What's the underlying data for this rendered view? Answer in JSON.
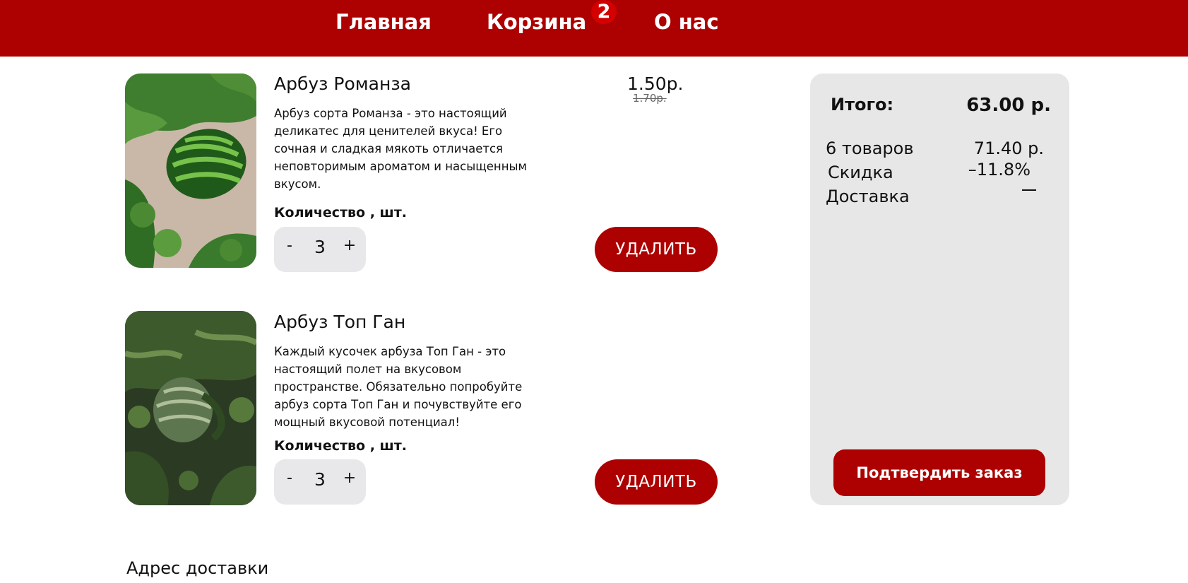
{
  "nav": {
    "home_label": "Главная",
    "cart_label": "Корзина",
    "cart_count": "2",
    "about_label": "О нас"
  },
  "items": [
    {
      "title": "Арбуз Романза",
      "description": "Арбуз сорта Романза - это настоящий деликатес для ценителей вкуса! Его сочная и сладкая мякоть отличается неповторимым ароматом и насыщенным вкусом.",
      "quantity_label": "Количество , шт.",
      "quantity": "3",
      "minus_label": "-",
      "plus_label": "+",
      "price": "1.50р.",
      "old_price": "1.70р.",
      "delete_label": "УДАЛИТЬ"
    },
    {
      "title": "Арбуз Топ Ган",
      "description": "Каждый кусочек арбуза Топ Ган - это настоящий полет на вкусовом пространстве. Обязательно попробуйте арбуз сорта Топ Ган и почувствуйте его мощный вкусовой потенциал!",
      "quantity_label": "Количество , шт.",
      "quantity": "3",
      "minus_label": "-",
      "plus_label": "+",
      "delete_label": "УДАЛИТЬ"
    }
  ],
  "summary": {
    "total_label": "Итого:",
    "total_value": "63.00 р.",
    "items_label": "6 товаров",
    "items_value": "71.40 р.",
    "discount_label": "Скидка",
    "discount_value": "–11.8%",
    "delivery_label": "Доставка",
    "confirm_label": "Подтвердить заказ"
  },
  "address": {
    "title": "Адрес доставки"
  },
  "colors": {
    "brand_red": "#ad0000",
    "panel_gray": "#e7e7e7",
    "stepper_gray": "#e8e8ea"
  }
}
